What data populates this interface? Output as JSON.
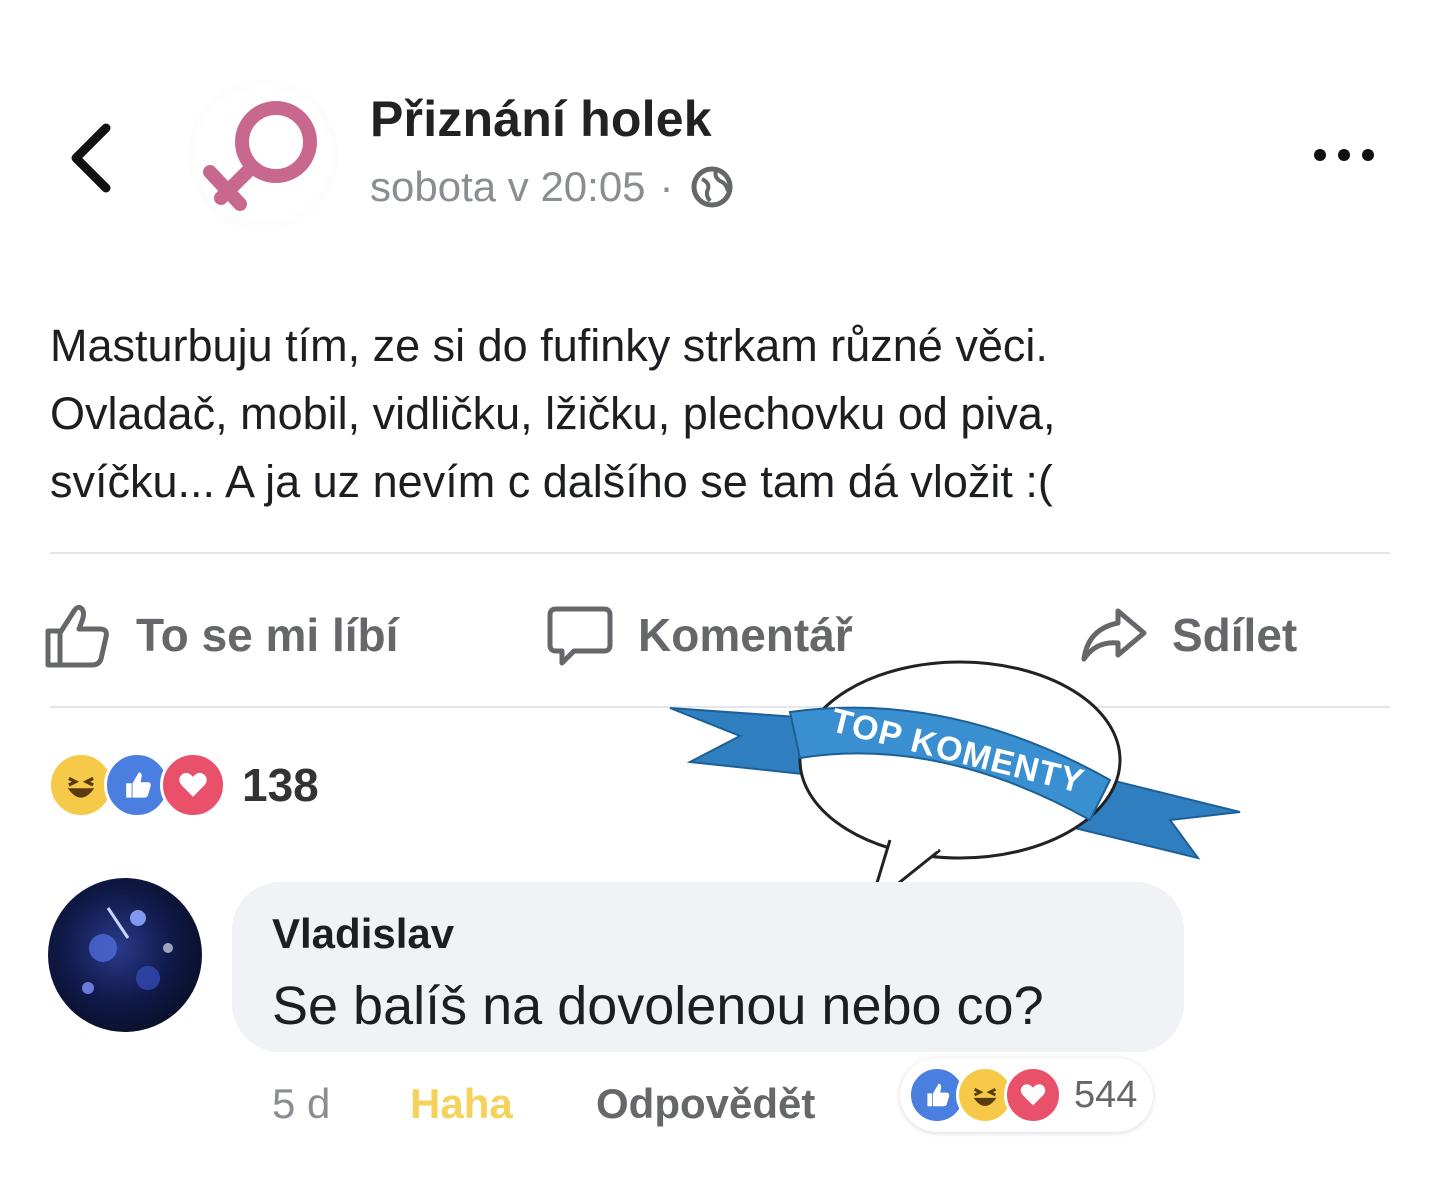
{
  "header": {
    "page_name": "Přiznání holek",
    "time": "sobota v 20:05",
    "separator": "·"
  },
  "post": {
    "text_lines": [
      "Masturbuju tím, ze si do fufinky strkam různé věci.",
      "Ovladač, mobil, vidličku, lžičku, plechovku od piva,",
      "svíčku... A ja uz nevím c dalšího se tam dá vložit :("
    ]
  },
  "actions": {
    "like": "To se mi líbí",
    "comment": "Komentář",
    "share": "Sdílet"
  },
  "reactions": {
    "count": "138",
    "icons": [
      "haha-icon",
      "like-icon",
      "love-icon"
    ]
  },
  "badge": {
    "text": "TOP KOMENTY"
  },
  "comment": {
    "author": "Vladislav",
    "text": "Se balíš na dovolenou nebo co?",
    "time": "5 d",
    "reaction_label": "Haha",
    "reply_label": "Odpovědět",
    "reaction_count": "544",
    "reaction_icons": [
      "like-icon",
      "haha-icon",
      "love-icon"
    ]
  },
  "colors": {
    "like_blue": "#4a7fe0",
    "love_red": "#e9506a",
    "haha_yellow": "#f7c948",
    "badge_blue": "#3a8fd0",
    "venus_pink": "#c9688f"
  }
}
